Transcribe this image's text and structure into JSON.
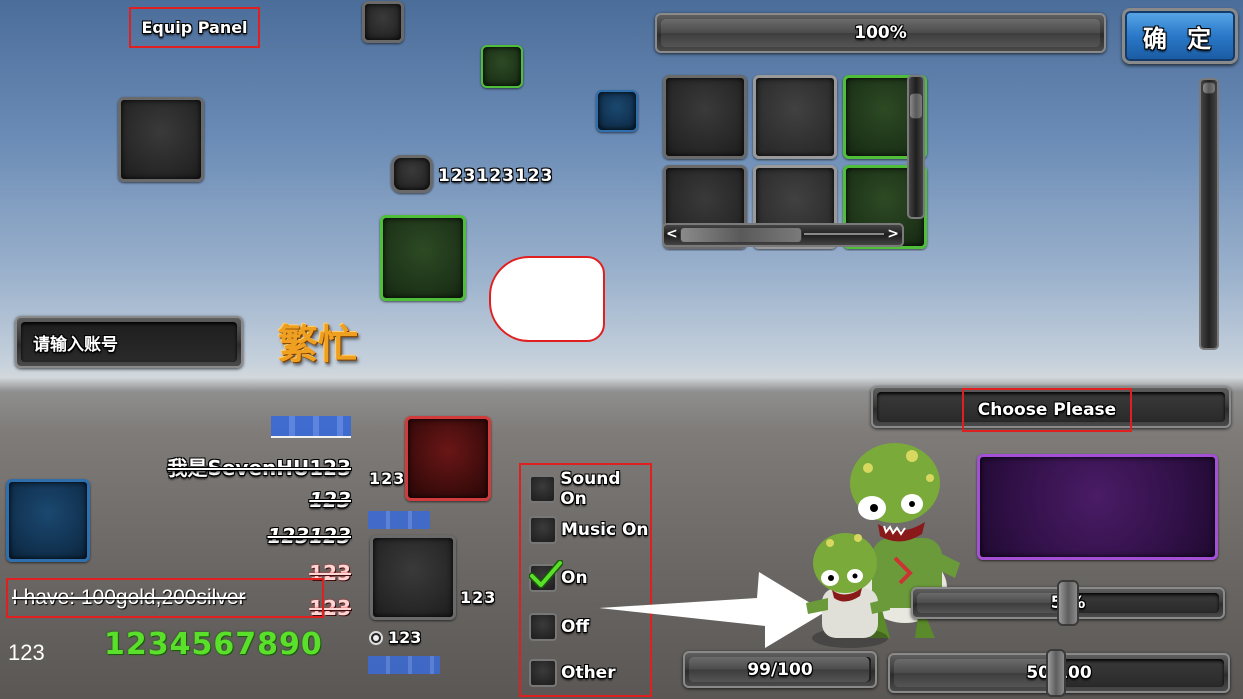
{
  "equip_panel": {
    "title": "Equip Panel"
  },
  "progress_top": {
    "label": "100%",
    "value": 100
  },
  "confirm_button": {
    "label": "确 定"
  },
  "inline_slot_label": "123123123",
  "busy_label": "繁忙",
  "account_input": {
    "placeholder": "请输入账号"
  },
  "dropdown": {
    "label": "Choose Please"
  },
  "text_stack": {
    "line1": "我是SevenHU123",
    "line2": "123",
    "line3": "123123",
    "line4": "123",
    "line5": "123"
  },
  "inline_gold": "I have: 100gold,200silver",
  "bottom_left_number": "123",
  "green_digits": "1234567890",
  "red_slot_label": "123",
  "small_slot_label": "123",
  "radio_label": "123",
  "toggles": [
    {
      "label": "Sound On",
      "checked": false
    },
    {
      "label": "Music On",
      "checked": false
    },
    {
      "label": "On",
      "checked": true
    },
    {
      "label": "Off",
      "checked": false
    },
    {
      "label": "Other",
      "checked": false
    }
  ],
  "slider_volume": {
    "label": "5 %",
    "value": 50
  },
  "hp_bar": {
    "label": "99/100",
    "value": 99
  },
  "slider_bottom": {
    "label": "50/100",
    "value": 50
  },
  "icons": {
    "check": "checkmark-icon",
    "left_arrow": "chevron-left-icon",
    "right_arrow": "chevron-right-icon",
    "zombie": "zombie-sprite",
    "arrow": "white-arrow-shape"
  },
  "colors": {
    "frame_red": "#e02020",
    "slot_green": "#4fbf3a",
    "slot_blue": "#2f6fae",
    "slot_red": "#d13b3b",
    "slot_purple": "#a34fd6",
    "busy_orange": "#f0a020",
    "digits_green": "#5ae02a",
    "link_blue": "#3a6ad8"
  }
}
